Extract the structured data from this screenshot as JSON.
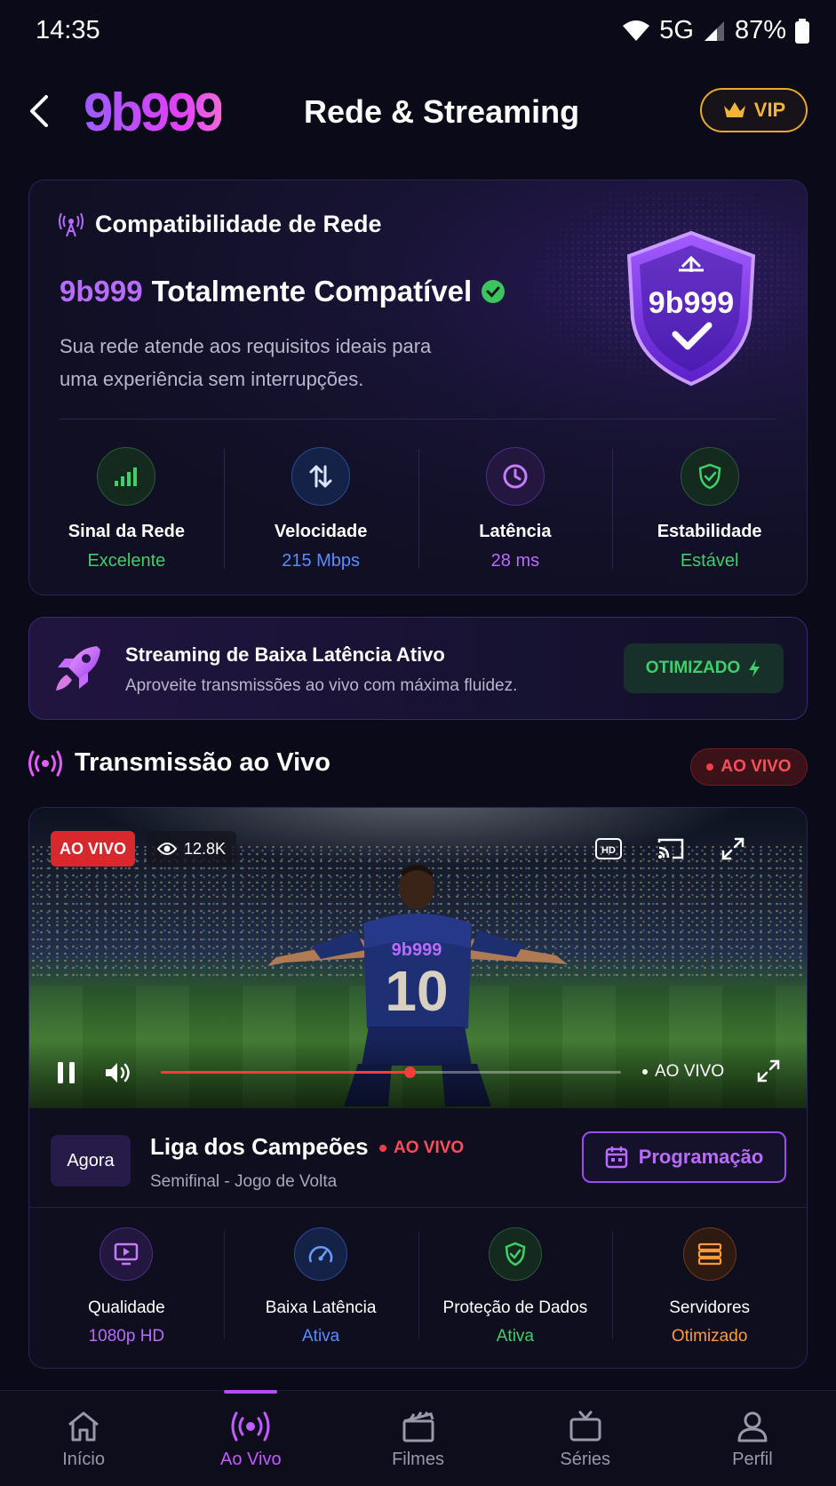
{
  "status_bar": {
    "time": "14:35",
    "network": "5G",
    "battery": "87%"
  },
  "header": {
    "logo": "9b999",
    "title": "Rede & Streaming",
    "vip_label": "VIP"
  },
  "compat": {
    "title": "Compatibilidade de Rede",
    "brand": "9b999",
    "headline": "Totalmente Compatível",
    "description": "Sua rede atende aos requisitos ideais para uma experiência sem interrupções.",
    "shield_text": "9b999",
    "metrics": [
      {
        "label": "Sinal da Rede",
        "value": "Excelente",
        "icon": "signal-bars-icon",
        "color": "#3ed06a"
      },
      {
        "label": "Velocidade",
        "value": "215 Mbps",
        "icon": "transfer-arrows-icon",
        "color": "#5b8cff"
      },
      {
        "label": "Latência",
        "value": "28 ms",
        "icon": "clock-icon",
        "color": "#b86bff"
      },
      {
        "label": "Estabilidade",
        "value": "Estável",
        "icon": "shield-check-icon",
        "color": "#3ed06a"
      }
    ]
  },
  "banner": {
    "title": "Streaming de Baixa Latência Ativo",
    "subtitle": "Aproveite transmissões ao vivo com máxima fluidez.",
    "badge": "OTIMIZADO"
  },
  "live_section": {
    "title": "Transmissão ao Vivo",
    "pill": "AO VIVO"
  },
  "video": {
    "badge": "AO VIVO",
    "viewers": "12.8K",
    "hd_label": "HD",
    "jersey_brand": "9b999",
    "jersey_number": "10",
    "progress": 0.54,
    "live_label": "AO VIVO"
  },
  "now_playing": {
    "badge": "Agora",
    "title": "Liga dos Campeões",
    "live": "AO VIVO",
    "subtitle": "Semifinal - Jogo de Volta",
    "schedule_button": "Programação"
  },
  "features": [
    {
      "label": "Qualidade",
      "value": "1080p HD",
      "icon": "monitor-play-icon",
      "color": "#b86bff"
    },
    {
      "label": "Baixa Latência",
      "value": "Ativa",
      "icon": "speedometer-icon",
      "color": "#5b8cff"
    },
    {
      "label": "Proteção de Dados",
      "value": "Ativa",
      "icon": "shield-check-icon",
      "color": "#3ed06a"
    },
    {
      "label": "Servidores",
      "value": "Otimizado",
      "icon": "server-icon",
      "color": "#ff9a3c"
    }
  ],
  "bottom_nav": [
    {
      "label": "Início",
      "icon": "home-icon",
      "active": false
    },
    {
      "label": "Ao Vivo",
      "icon": "broadcast-icon",
      "active": true
    },
    {
      "label": "Filmes",
      "icon": "clapperboard-icon",
      "active": false
    },
    {
      "label": "Séries",
      "icon": "tv-icon",
      "active": false
    },
    {
      "label": "Perfil",
      "icon": "user-icon",
      "active": false
    }
  ]
}
